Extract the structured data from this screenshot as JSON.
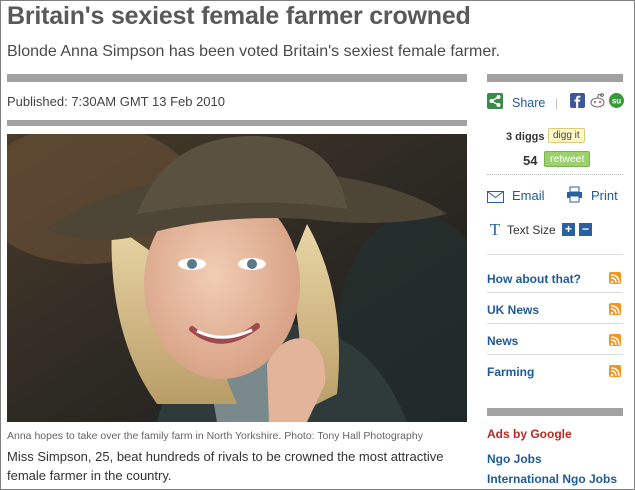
{
  "article": {
    "headline": "Britain's sexiest female farmer crowned",
    "standfirst": "Blonde Anna Simpson has been voted Britain's sexiest female farmer.",
    "published": "Published: 7:30AM GMT 13 Feb 2010",
    "photo_caption": "Anna hopes to take over the family farm in North Yorkshire.  Photo: Tony Hall Photography",
    "body": "Miss Simpson, 25, beat hundreds of rivals to be crowned the most attractive female farmer in the country."
  },
  "sidebar": {
    "share_label": "Share",
    "share_separator": "|",
    "digg_count": "3 diggs",
    "digg_button": "digg it",
    "retweet_count": "54",
    "retweet_button": "retweet",
    "email_label": "Email",
    "print_label": "Print",
    "text_size_label": "Text Size",
    "text_size_plus": "+",
    "text_size_minus": "−",
    "nav": [
      {
        "label": "How about that?"
      },
      {
        "label": "UK News"
      },
      {
        "label": "News"
      },
      {
        "label": "Farming"
      }
    ],
    "ads_label": "Ads by Google",
    "ad_links": [
      "Ngo Jobs",
      "International Ngo Jobs"
    ]
  },
  "colors": {
    "link_blue": "#1f5a98",
    "headline_grey": "#58595b",
    "rss_orange": "#f7941d",
    "ads_red": "#b52a22",
    "retweet_green": "#9bd16b"
  },
  "icons": [
    "share-icon",
    "facebook-icon",
    "reddit-icon",
    "stumbleupon-icon",
    "email-icon",
    "print-icon",
    "text-size-icon",
    "rss-icon"
  ]
}
